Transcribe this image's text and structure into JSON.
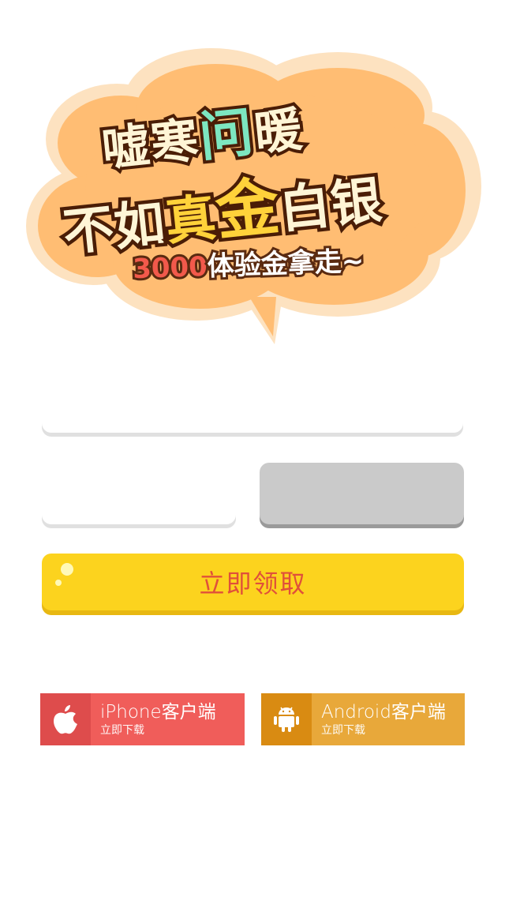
{
  "hero": {
    "line1_a": "嘘寒",
    "line1_b": "问",
    "line1_c": "暖",
    "line2_a": "不如",
    "line2_b": "真",
    "line2_c": "金",
    "line2_d": "白银",
    "amount": "3000",
    "line3_rest": "体验金拿走~"
  },
  "form": {
    "phone_value": "",
    "code_value": "",
    "code_button_label": "",
    "claim_label": "立即领取"
  },
  "downloads": {
    "ios": {
      "title": "iPhone客户端",
      "sub": "立即下载",
      "icon": "apple-icon"
    },
    "android": {
      "title": "Android客户端",
      "sub": "立即下载",
      "icon": "android-icon"
    }
  },
  "colors": {
    "claim": "#fcd31e",
    "claim_text": "#e0503a",
    "ios": "#f05d5a",
    "android": "#e8a83a",
    "cloud": "#ffbd73"
  }
}
